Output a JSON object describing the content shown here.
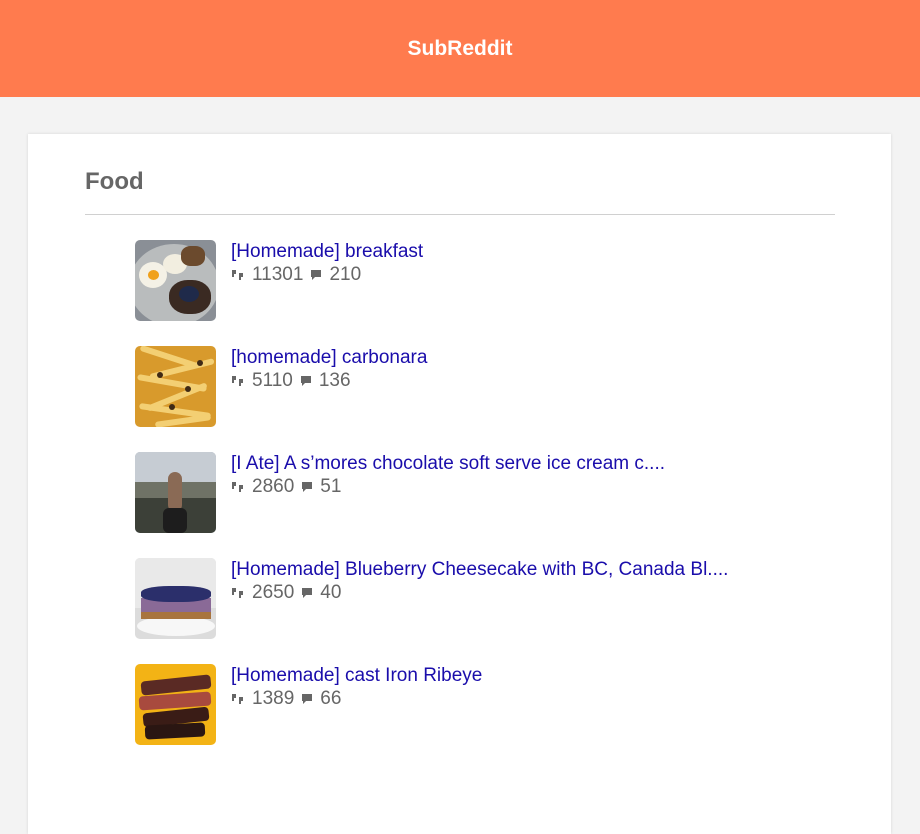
{
  "header": {
    "title": "SubReddit"
  },
  "section": {
    "title": "Food"
  },
  "icons": {
    "score": "upvote-icon",
    "comments": "comment-icon"
  },
  "colors": {
    "header_bg": "#ff7b4e",
    "link": "#1a0dab",
    "page_bg": "#f3f3f3"
  },
  "posts": [
    {
      "title": "[Homemade] breakfast",
      "score": "11301",
      "comments": "210",
      "thumbnail": "breakfast-thumbnail"
    },
    {
      "title": "[homemade] carbonara",
      "score": "5110",
      "comments": "136",
      "thumbnail": "carbonara-thumbnail"
    },
    {
      "title": "[I Ate] A s’mores chocolate soft serve ice cream c....",
      "score": "2860",
      "comments": "51",
      "thumbnail": "ice-cream-thumbnail"
    },
    {
      "title": "[Homemade] Blueberry Cheesecake with BC, Canada Bl....",
      "score": "2650",
      "comments": "40",
      "thumbnail": "cheesecake-thumbnail"
    },
    {
      "title": "[Homemade] cast Iron Ribeye",
      "score": "1389",
      "comments": "66",
      "thumbnail": "ribeye-thumbnail"
    }
  ]
}
